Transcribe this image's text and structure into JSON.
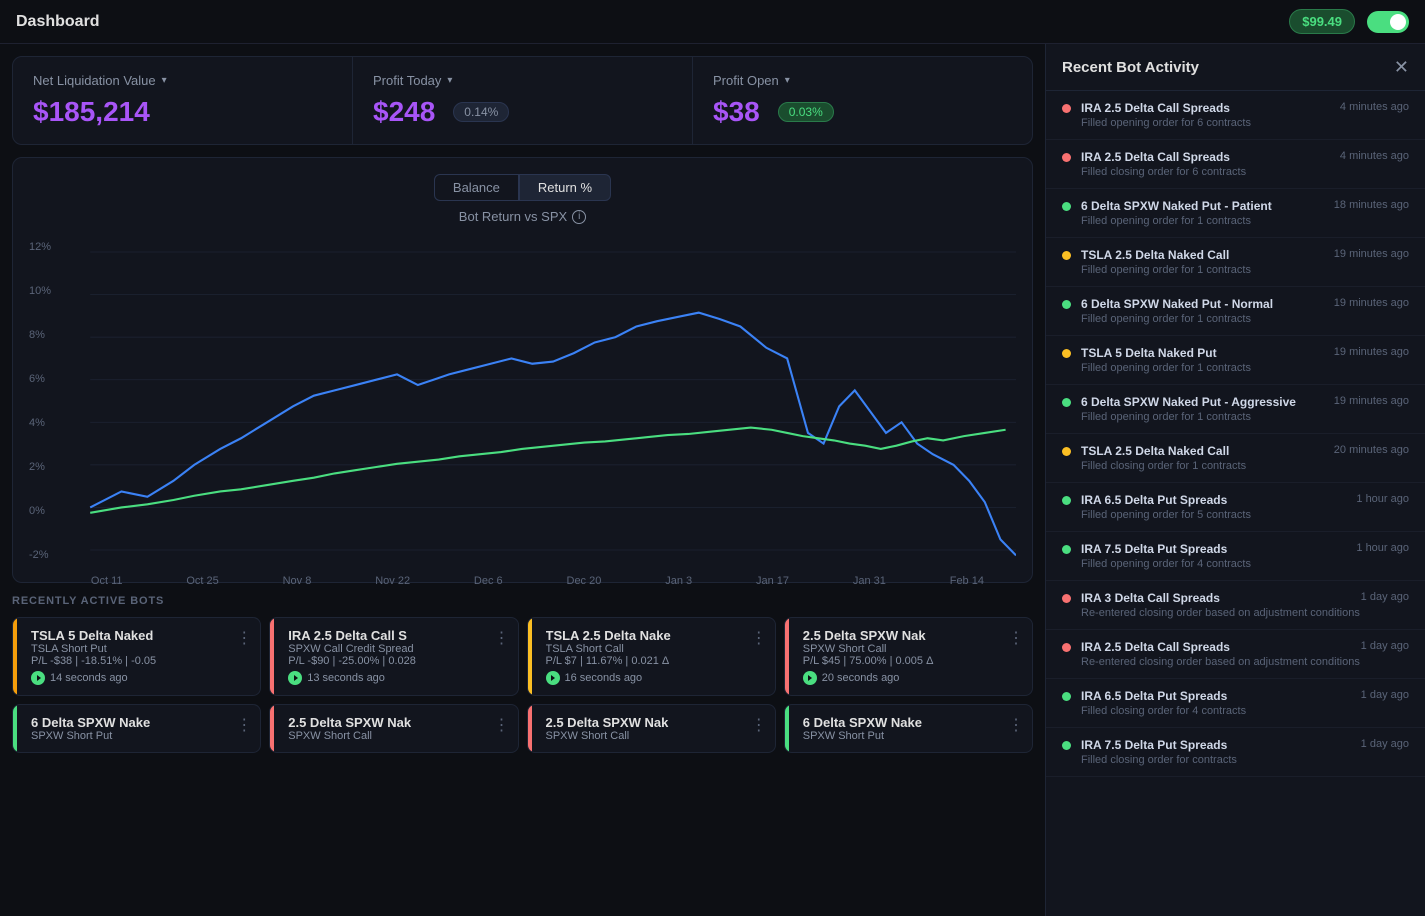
{
  "header": {
    "title": "Dashboard",
    "balance": "$99.49",
    "toggle_on": true
  },
  "stats": {
    "net_liquidation": {
      "label": "Net Liquidation Value",
      "value": "$185,214"
    },
    "profit_today": {
      "label": "Profit Today",
      "value": "$248",
      "badge": "0.14%"
    },
    "profit_open": {
      "label": "Profit Open",
      "value": "$38",
      "badge": "0.03%"
    }
  },
  "chart": {
    "title": "Bot Return vs SPX",
    "btn_balance": "Balance",
    "btn_return": "Return %",
    "y_labels": [
      "12%",
      "10%",
      "8%",
      "6%",
      "4%",
      "2%",
      "0%",
      "-2%"
    ],
    "x_labels": [
      "Oct 11",
      "Oct 25",
      "Nov 8",
      "Nov 22",
      "Dec 6",
      "Dec 20",
      "Jan 3",
      "Jan 17",
      "Jan 31",
      "Feb 14"
    ]
  },
  "bots_section": {
    "title": "RECENTLY ACTIVE BOTS",
    "bots": [
      {
        "name": "TSLA 5 Delta Naked",
        "sub": "TSLA Short Put",
        "pnl": "P/L -$38 | -18.51% | -0.05",
        "time": "14 seconds ago",
        "accent": "#f59e0b",
        "active": true
      },
      {
        "name": "IRA 2.5 Delta Call S",
        "sub": "SPXW Call Credit Spread",
        "pnl": "P/L -$90 | -25.00% | 0.028",
        "time": "13 seconds ago",
        "accent": "#f87171",
        "active": true
      },
      {
        "name": "TSLA 2.5 Delta Nake",
        "sub": "TSLA Short Call",
        "pnl": "P/L $7 | 11.67% | 0.021 Δ",
        "time": "16 seconds ago",
        "accent": "#fbbf24",
        "active": true
      },
      {
        "name": "2.5 Delta SPXW Nak",
        "sub": "SPXW Short Call",
        "pnl": "P/L $45 | 75.00% | 0.005 Δ",
        "time": "20 seconds ago",
        "accent": "#f87171",
        "active": true
      },
      {
        "name": "6 Delta SPXW Nake",
        "sub": "SPXW Short Put",
        "pnl": "",
        "time": "",
        "accent": "#4ade80",
        "active": false
      },
      {
        "name": "2.5 Delta SPXW Nak",
        "sub": "SPXW Short Call",
        "pnl": "",
        "time": "",
        "accent": "#f87171",
        "active": false
      },
      {
        "name": "2.5 Delta SPXW Nak",
        "sub": "SPXW Short Call",
        "pnl": "",
        "time": "",
        "accent": "#f87171",
        "active": false
      },
      {
        "name": "6 Delta SPXW Nake",
        "sub": "SPXW Short Put",
        "pnl": "",
        "time": "",
        "accent": "#4ade80",
        "active": false
      }
    ]
  },
  "activity_panel": {
    "title": "Recent Bot Activity",
    "items": [
      {
        "name": "IRA 2.5 Delta Call Spreads",
        "time": "4 minutes ago",
        "desc": "Filled opening order for 6 contracts",
        "dot": "red"
      },
      {
        "name": "IRA 2.5 Delta Call Spreads",
        "time": "4 minutes ago",
        "desc": "Filled closing order for 6 contracts",
        "dot": "red"
      },
      {
        "name": "6 Delta SPXW Naked Put - Patient",
        "time": "18 minutes ago",
        "desc": "Filled opening order for 1 contracts",
        "dot": "green"
      },
      {
        "name": "TSLA 2.5 Delta Naked Call",
        "time": "19 minutes ago",
        "desc": "Filled opening order for 1 contracts",
        "dot": "yellow"
      },
      {
        "name": "6 Delta SPXW Naked Put - Normal",
        "time": "19 minutes ago",
        "desc": "Filled opening order for 1 contracts",
        "dot": "green"
      },
      {
        "name": "TSLA 5 Delta Naked Put",
        "time": "19 minutes ago",
        "desc": "Filled opening order for 1 contracts",
        "dot": "yellow"
      },
      {
        "name": "6 Delta SPXW Naked Put - Aggressive",
        "time": "19 minutes ago",
        "desc": "Filled opening order for 1 contracts",
        "dot": "green"
      },
      {
        "name": "TSLA 2.5 Delta Naked Call",
        "time": "20 minutes ago",
        "desc": "Filled closing order for 1 contracts",
        "dot": "yellow"
      },
      {
        "name": "IRA 6.5 Delta Put Spreads",
        "time": "1 hour ago",
        "desc": "Filled opening order for 5 contracts",
        "dot": "green"
      },
      {
        "name": "IRA 7.5 Delta Put Spreads",
        "time": "1 hour ago",
        "desc": "Filled opening order for 4 contracts",
        "dot": "green"
      },
      {
        "name": "IRA 3 Delta Call Spreads",
        "time": "1 day ago",
        "desc": "Re-entered closing order based on adjustment conditions",
        "dot": "red"
      },
      {
        "name": "IRA 2.5 Delta Call Spreads",
        "time": "1 day ago",
        "desc": "Re-entered closing order based on adjustment conditions",
        "dot": "red"
      },
      {
        "name": "IRA 6.5 Delta Put Spreads",
        "time": "1 day ago",
        "desc": "Filled closing order for 4 contracts",
        "dot": "green"
      },
      {
        "name": "IRA 7.5 Delta Put Spreads",
        "time": "1 day ago",
        "desc": "Filled closing order for contracts",
        "dot": "green"
      }
    ]
  }
}
